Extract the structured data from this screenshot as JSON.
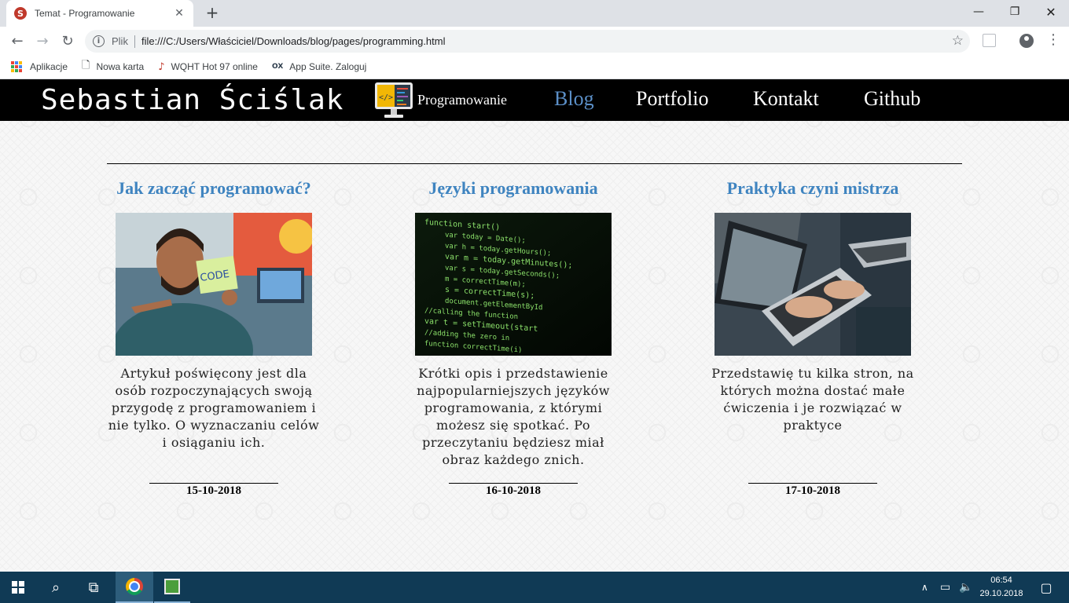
{
  "browser": {
    "tab_title": "Temat - Programowanie",
    "tab_close": "✕",
    "new_tab": "+",
    "window_controls": {
      "minimize": "—",
      "maximize": "❐",
      "close": "✕"
    },
    "nav": {
      "back": "←",
      "forward": "→",
      "reload": "↻"
    },
    "address": {
      "info": "i",
      "scheme_label": "Plik",
      "url": "file:///C:/Users/Właściciel/Downloads/blog/pages/programming.html",
      "star": "☆"
    },
    "menu": "⋮",
    "bookmarks": [
      {
        "label": "Aplikacje",
        "icon": "apps-grid-icon"
      },
      {
        "label": "Nowa karta",
        "icon": "page-icon",
        "glyph": "🗋"
      },
      {
        "label": "WQHT Hot 97 online",
        "icon": "radio-icon",
        "glyph": "♪"
      },
      {
        "label": "App Suite. Zaloguj",
        "icon": "ox-icon",
        "glyph": "OX"
      }
    ]
  },
  "site": {
    "name": "Sebastian Ściślak",
    "nav": [
      {
        "label": "Programowanie",
        "active": false
      },
      {
        "label": "Blog",
        "active": true
      },
      {
        "label": "Portfolio",
        "active": false
      },
      {
        "label": "Kontakt",
        "active": false
      },
      {
        "label": "Github",
        "active": false
      }
    ],
    "monitor_code_glyph": "</>"
  },
  "articles": [
    {
      "title": "Jak zacząć programować?",
      "text": "Artykuł poświęcony jest dla osób rozpoczynających swoją przygodę z programowaniem i nie tylko. O wyznaczaniu celów i osiąganiu ich.",
      "date": "15-10-2018",
      "image_note": "CODE"
    },
    {
      "title": "Języki programowania",
      "text": "Krótki opis i przedstawienie najpopularniejszych języków programowania, z którymi możesz się spotkać. Po przeczytaniu będziesz miał obraz każdego znich.",
      "date": "16-10-2018",
      "code_lines": [
        "function start()",
        "var today = Date();",
        "var h = today.getHours();",
        "var m = today.getMinutes();",
        "var s = today.getSeconds();",
        "m = correctTime(m);",
        "s = correctTime(s);",
        "document.getElementById",
        "//calling the function",
        "var t = setTimeout(start",
        "//adding the zero in",
        "function correctTime(i)"
      ]
    },
    {
      "title": "Praktyka czyni mistrza",
      "text": "Przedstawię tu kilka stron, na których można dostać małe ćwiczenia i je rozwiązać w praktyce",
      "date": "17-10-2018"
    }
  ],
  "taskbar": {
    "search_glyph": "⌕",
    "task_view_glyph": "⧉",
    "tray_up": "∧",
    "tray_network": "▭",
    "tray_volume": "🔈",
    "time": "06:54",
    "date": "29.10.2018",
    "notifications_glyph": "▢"
  },
  "colors": {
    "accent_title": "#3f84c0",
    "nav_active": "#5b8fc7",
    "nav_bg": "#000000",
    "taskbar_bg": "#103a55"
  }
}
